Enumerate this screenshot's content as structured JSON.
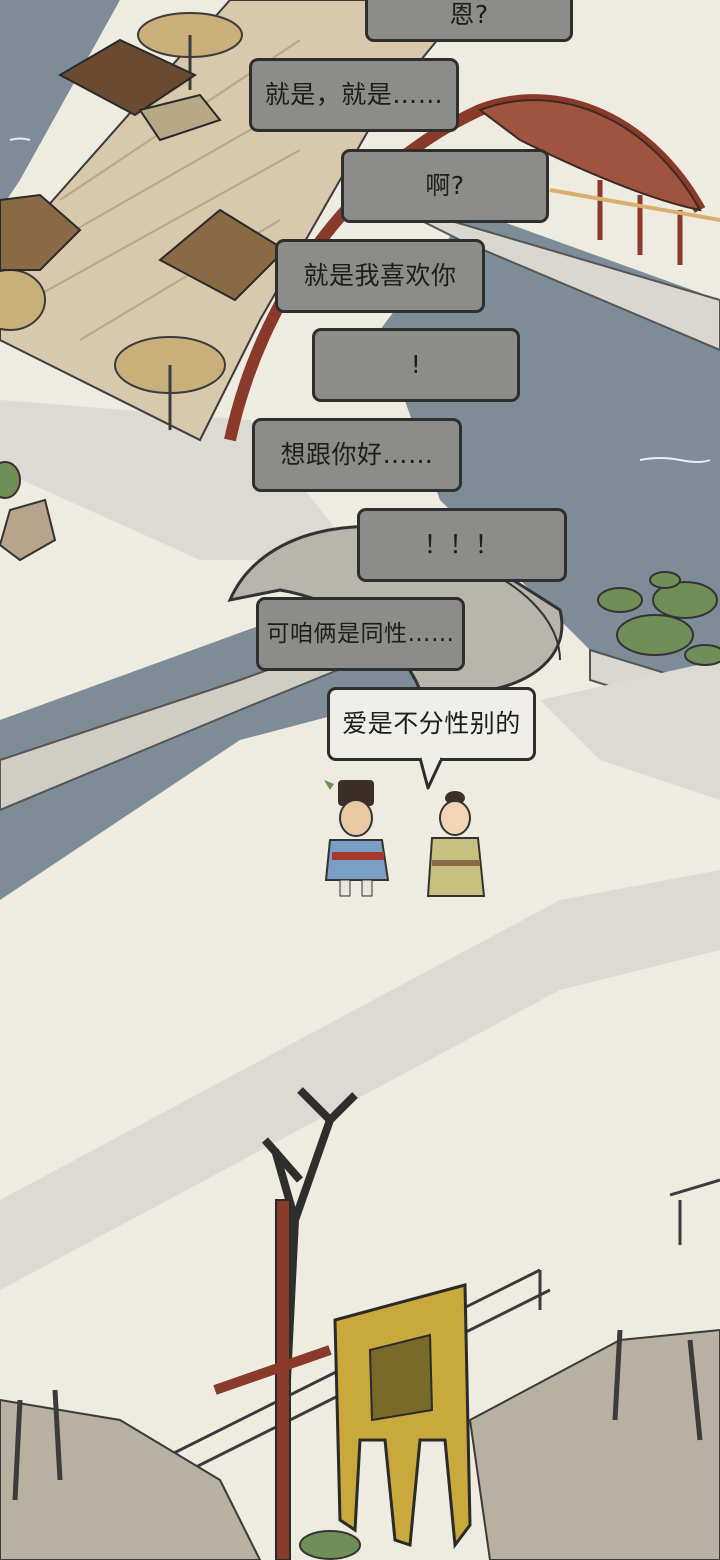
{
  "dialogue": [
    {
      "id": "b1",
      "text": "恩?",
      "speaker": "right"
    },
    {
      "id": "b2",
      "text": "就是，就是……",
      "speaker": "left"
    },
    {
      "id": "b3",
      "text": "啊?",
      "speaker": "right"
    },
    {
      "id": "b4",
      "text": "就是我喜欢你",
      "speaker": "left"
    },
    {
      "id": "b5",
      "text": "!",
      "speaker": "right"
    },
    {
      "id": "b6",
      "text": "想跟你好……",
      "speaker": "left"
    },
    {
      "id": "b7",
      "text": "！！！",
      "speaker": "right"
    },
    {
      "id": "b8",
      "text": "可咱俩是同性……",
      "speaker": "left"
    },
    {
      "id": "b9",
      "text": "爱是不分性别的",
      "speaker": "right",
      "active": true
    }
  ],
  "colors": {
    "ground": "#eeebe0",
    "water": "#7e8c97",
    "bubble_faded": "#8c8c8a",
    "bubble_active": "#efeee9",
    "bubble_border": "#2e2e2c",
    "bridge_wood": "#d8c9ad",
    "rail_red": "#8a3a2a",
    "banner_yellow": "#c9a93c"
  },
  "characters": [
    {
      "name": "guard",
      "robe": "#7a9fc6"
    },
    {
      "name": "young-man",
      "robe": "#c8c080"
    }
  ]
}
